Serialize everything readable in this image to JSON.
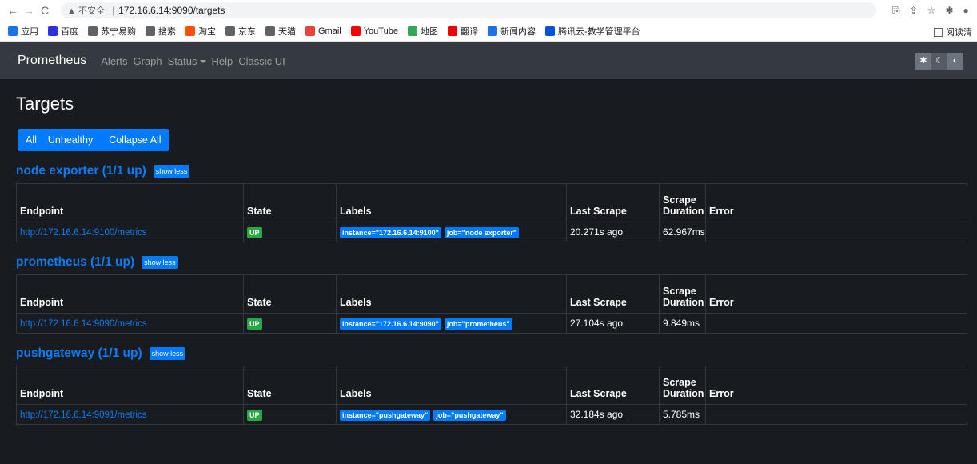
{
  "browser": {
    "back": "←",
    "forward": "→",
    "reload": "C",
    "security": "▲ 不安全",
    "url": "172.16.6.14:9090/targets",
    "bookmarks": [
      {
        "label": "应用",
        "color": "#1a73e8"
      },
      {
        "label": "百度",
        "color": "#2932e1"
      },
      {
        "label": "苏宁易购",
        "color": "#5f6368"
      },
      {
        "label": "搜索",
        "color": "#5f6368"
      },
      {
        "label": "淘宝",
        "color": "#ff5000"
      },
      {
        "label": "京东",
        "color": "#5f6368"
      },
      {
        "label": "天猫",
        "color": "#5f6368"
      },
      {
        "label": "Gmail",
        "color": "#ea4335"
      },
      {
        "label": "YouTube",
        "color": "#ff0000"
      },
      {
        "label": "地图",
        "color": "#34a853"
      },
      {
        "label": "翻译",
        "color": "#e00"
      },
      {
        "label": "新闻内容",
        "color": "#1a73e8"
      },
      {
        "label": "腾讯云-教学管理平台",
        "color": "#0052d9"
      }
    ],
    "reading_list": "阅读清"
  },
  "navbar": {
    "brand": "Prometheus",
    "links": [
      "Alerts",
      "Graph"
    ],
    "status": "Status",
    "links2": [
      "Help",
      "Classic UI"
    ]
  },
  "page": {
    "title": "Targets",
    "filters": [
      "All",
      "Unhealthy",
      "Collapse All"
    ],
    "columns": [
      "Endpoint",
      "State",
      "Labels",
      "Last Scrape",
      "Scrape Duration",
      "Error"
    ],
    "show_less": "show less"
  },
  "pools": [
    {
      "title": "node exporter (1/1 up)",
      "targets": [
        {
          "endpoint": "http://172.16.6.14:9100/metrics",
          "state": "UP",
          "labels": [
            "instance=\"172.16.6.14:9100\"",
            "job=\"node exporter\""
          ],
          "last_scrape": "20.271s ago",
          "duration": "62.967ms",
          "error": ""
        }
      ]
    },
    {
      "title": "prometheus (1/1 up)",
      "targets": [
        {
          "endpoint": "http://172.16.6.14:9090/metrics",
          "state": "UP",
          "labels": [
            "instance=\"172.16.6.14:9090\"",
            "job=\"prometheus\""
          ],
          "last_scrape": "27.104s ago",
          "duration": "9.849ms",
          "error": ""
        }
      ]
    },
    {
      "title": "pushgateway (1/1 up)",
      "targets": [
        {
          "endpoint": "http://172.16.6.14:9091/metrics",
          "state": "UP",
          "labels": [
            "instance=\"pushgateway\"",
            "job=\"pushgateway\""
          ],
          "last_scrape": "32.184s ago",
          "duration": "5.785ms",
          "error": ""
        }
      ]
    }
  ]
}
